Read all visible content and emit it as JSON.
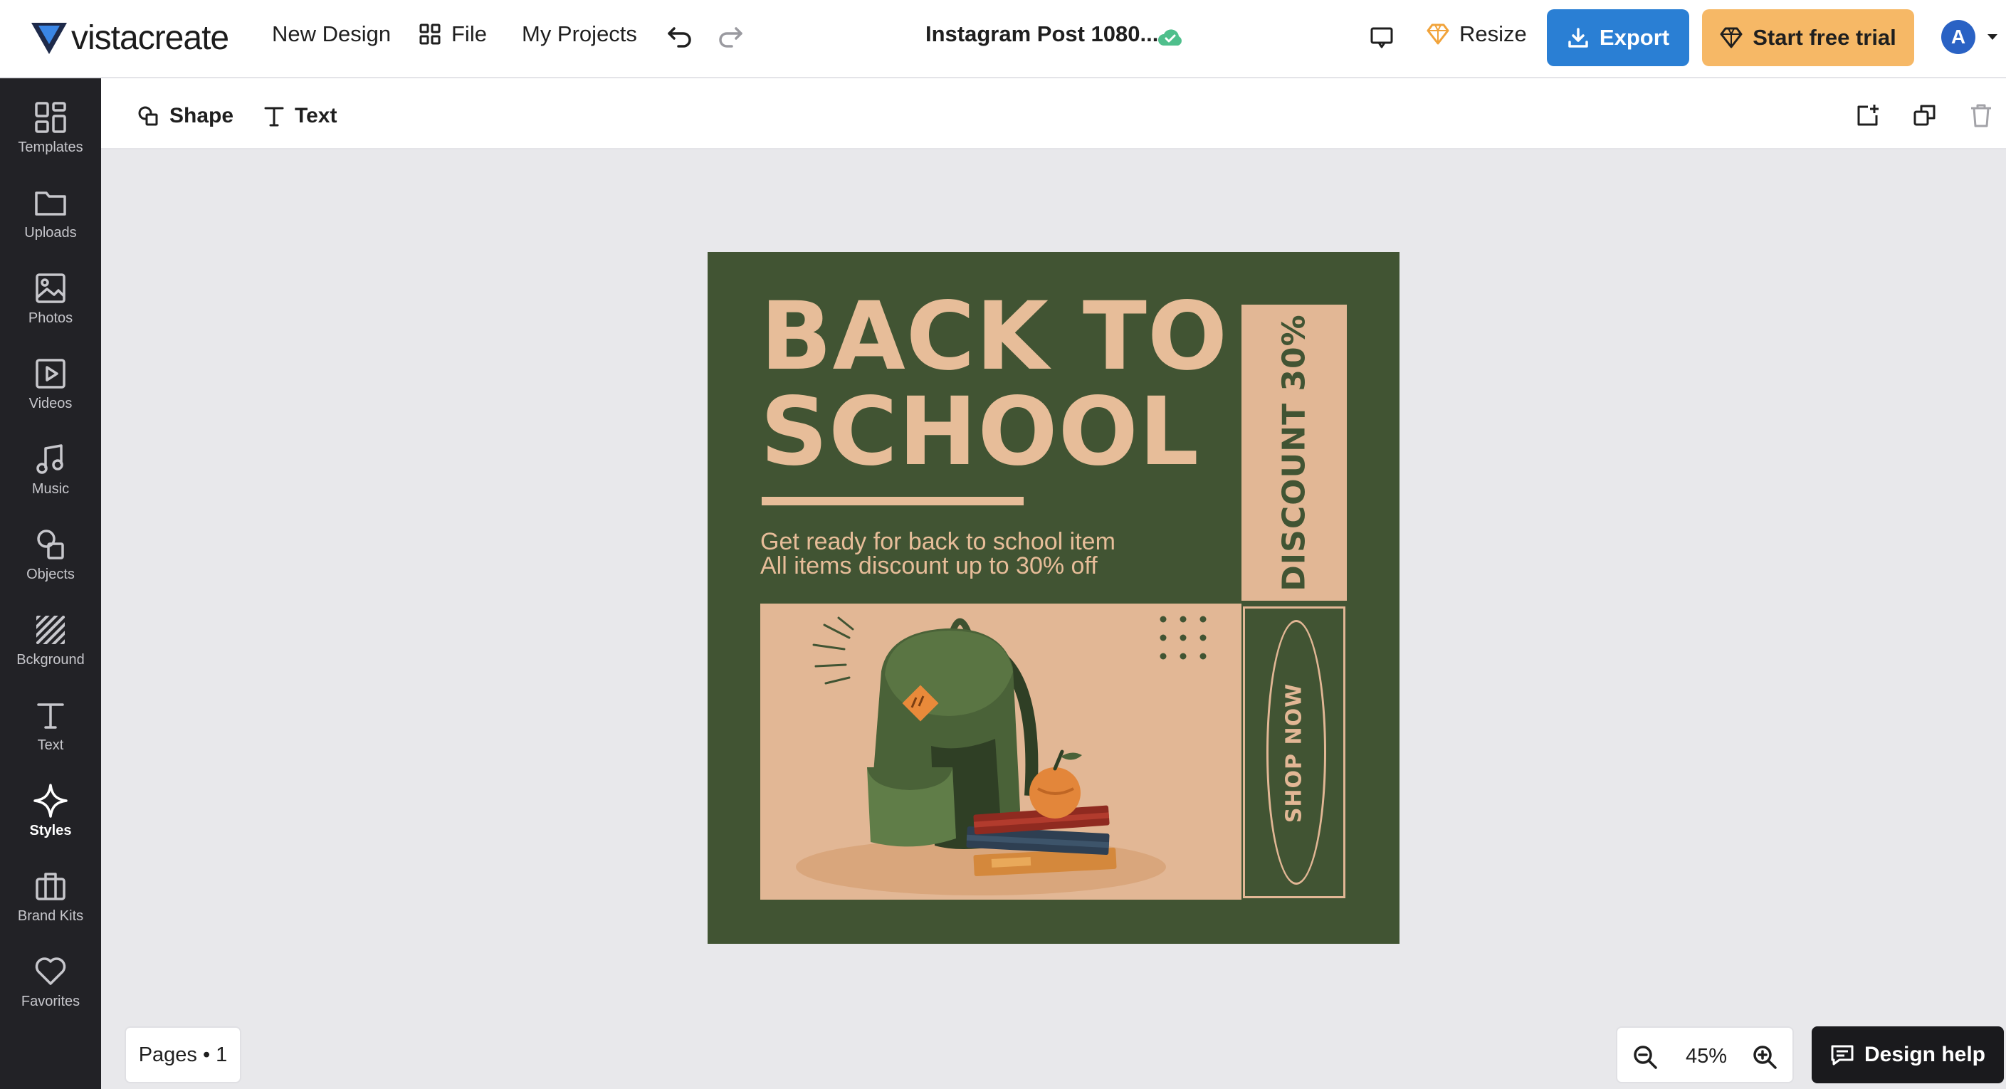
{
  "topbar": {
    "brand": "vistacreate",
    "new_design": "New Design",
    "file": "File",
    "my_projects": "My Projects",
    "doc_title": "Instagram Post 1080...",
    "resize": "Resize",
    "export": "Export",
    "start_trial": "Start free trial",
    "avatar_initial": "A"
  },
  "sidebar": {
    "items": [
      {
        "label": "Templates",
        "icon": "templates-icon"
      },
      {
        "label": "Uploads",
        "icon": "folder-icon"
      },
      {
        "label": "Photos",
        "icon": "image-icon"
      },
      {
        "label": "Videos",
        "icon": "video-icon"
      },
      {
        "label": "Music",
        "icon": "music-icon"
      },
      {
        "label": "Objects",
        "icon": "objects-icon"
      },
      {
        "label": "Bckground",
        "icon": "background-icon"
      },
      {
        "label": "Text",
        "icon": "text-icon"
      },
      {
        "label": "Styles",
        "icon": "sparkle-icon"
      },
      {
        "label": "Brand Kits",
        "icon": "briefcase-icon"
      },
      {
        "label": "Favorites",
        "icon": "heart-icon"
      }
    ],
    "active": "Styles"
  },
  "subbar": {
    "shape": "Shape",
    "text": "Text"
  },
  "design": {
    "headline_line1": "BACK TO",
    "headline_line2": "SCHOOL",
    "subtext_line1": "Get ready for back to school item",
    "subtext_line2": "All items discount up to 30% off",
    "discount": "DISCOUNT 30%",
    "shop_now": "SHOP NOW",
    "colors": {
      "background": "#415433",
      "accent": "#e7bd99",
      "panel": "#e2b795"
    }
  },
  "bottom": {
    "pages": "Pages • 1",
    "zoom": "45%",
    "design_help": "Design help"
  },
  "colors": {
    "export": "#2a7fd4",
    "trial": "#f6b866",
    "sidebar": "#222226"
  }
}
